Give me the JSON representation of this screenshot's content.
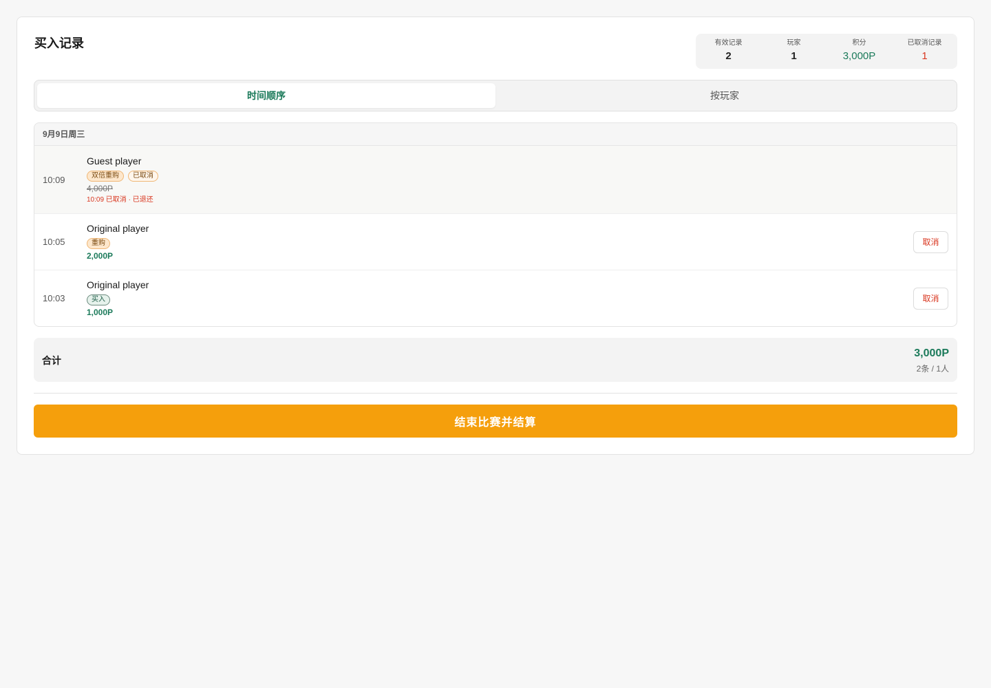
{
  "header": {
    "title": "买入记录"
  },
  "stats": [
    {
      "label": "有效记录",
      "value": "2",
      "color": "default"
    },
    {
      "label": "玩家",
      "value": "1",
      "color": "default"
    },
    {
      "label": "积分",
      "value": "3,000P",
      "color": "#1b7a5a"
    },
    {
      "label": "已取消记录",
      "value": "1",
      "color": "#d9361f"
    }
  ],
  "tabs": [
    {
      "label": "时间顺序",
      "active": true
    },
    {
      "label": "按玩家",
      "active": false
    }
  ],
  "records": {
    "date_header": "9月9日周三",
    "rows": [
      {
        "time": "10:09",
        "player": "Guest player",
        "badges": [
          "双倍重购",
          "已取消"
        ],
        "amount": "4,000P",
        "note": "10:09 已取消 · 已退还"
      },
      {
        "time": "10:05",
        "player": "Original player",
        "badges": [
          "重购"
        ],
        "amount": "2,000P",
        "cancel_label": "取消"
      },
      {
        "time": "10:03",
        "player": "Original player",
        "badges": [
          "买入"
        ],
        "amount": "1,000P",
        "cancel_label": "取消"
      }
    ]
  },
  "total": {
    "label": "合计",
    "amount": "3,000P",
    "sub": "2条 / 1人"
  },
  "finish_button": {
    "label": "结束比赛并结算"
  },
  "colors": {
    "accent_green": "#1b7a5a",
    "danger_red": "#d9361f",
    "primary_orange": "#f59f0c"
  }
}
